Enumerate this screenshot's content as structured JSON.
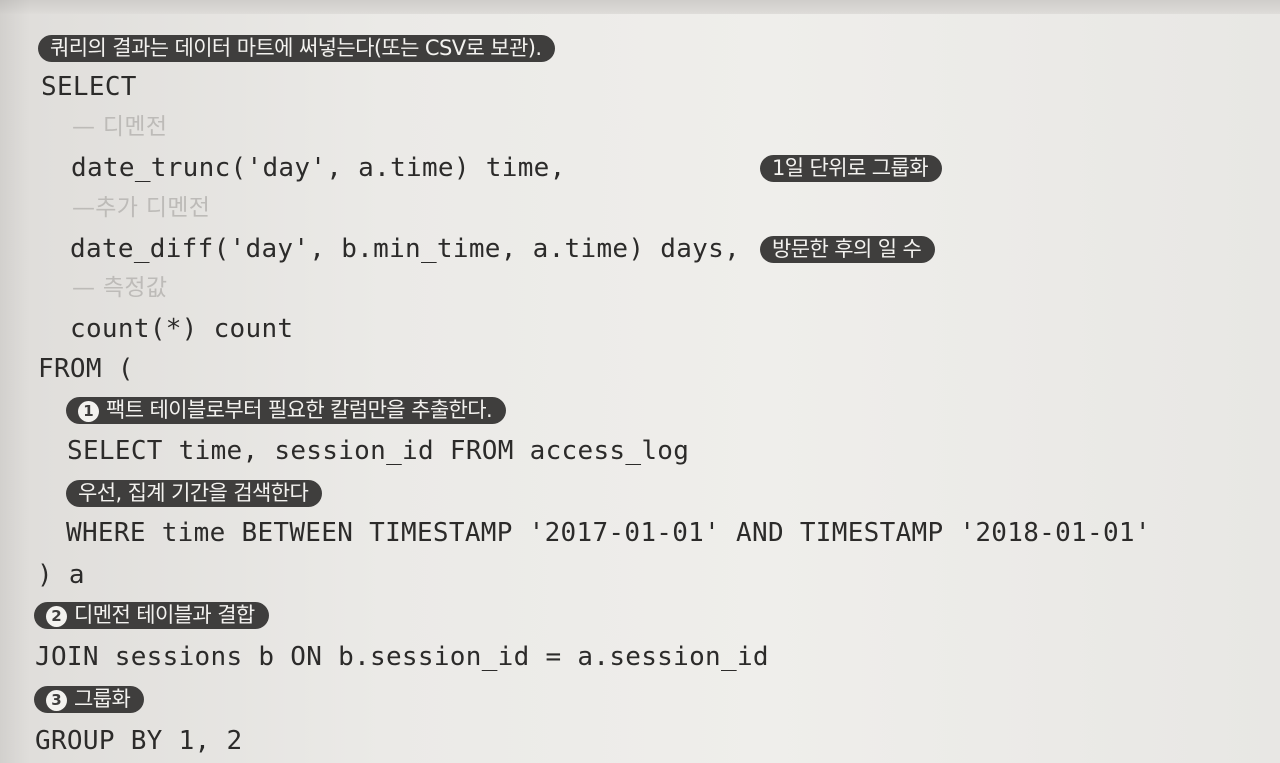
{
  "notes": {
    "write_to_mart": "쿼리의 결과는 데이터 마트에 써넣는다(또는 CSV로 보관).",
    "daily_group": "1일 단위로 그룹화",
    "days_after_visit": "방문한 후의 일 수",
    "step1_number": "1",
    "step1_label": "팩트 테이블로부터 필요한 칼럼만을 추출한다.",
    "first_search_period": "우선, 집계 기간을 검색한다",
    "step2_number": "2",
    "step2_label": "디멘전 테이블과 결합",
    "step3_number": "3",
    "step3_label": "그룹화"
  },
  "code": {
    "select": "SELECT",
    "comment_dimension": "— 디멘전",
    "date_trunc": "date_trunc('day', a.time) time,",
    "comment_extra_dimension": "—추가 디멘전",
    "date_diff": "date_diff('day', b.min_time, a.time) days,",
    "comment_measure": "— 측정값",
    "count": "count(*) count",
    "from": "FROM (",
    "sub_select": "SELECT time, session_id FROM access_log",
    "where": "WHERE time BETWEEN TIMESTAMP '2017-01-01' AND TIMESTAMP '2018-01-01'",
    "alias_close": ") a",
    "join": "JOIN sessions b ON b.session_id = a.session_id",
    "group_by": "GROUP BY 1, 2"
  }
}
